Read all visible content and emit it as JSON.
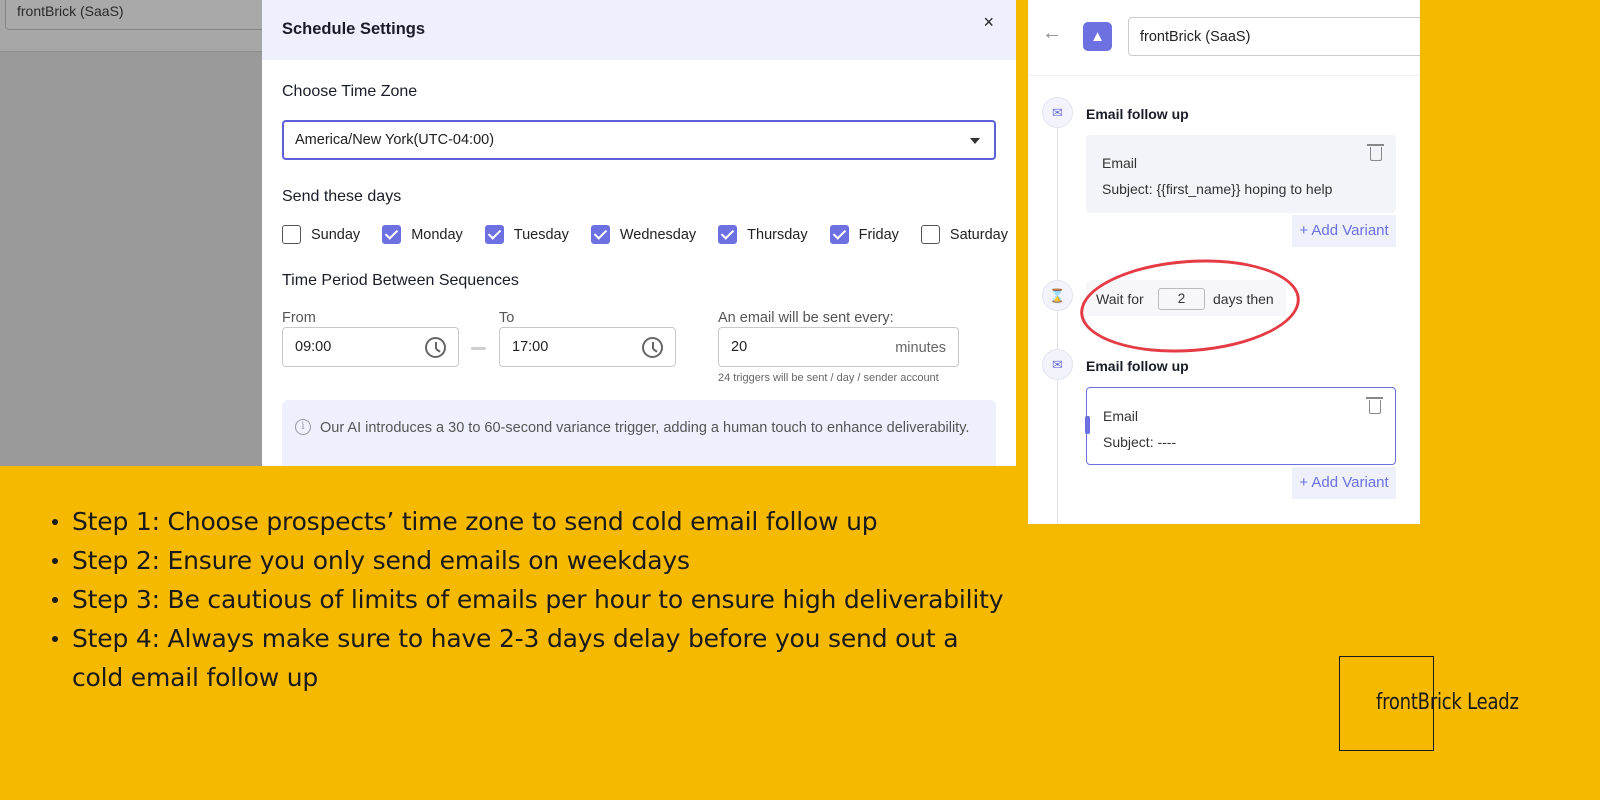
{
  "background_app": {
    "campaign_name": "frontBrick (SaaS)"
  },
  "modal": {
    "title": "Schedule Settings",
    "close_label": "×",
    "timezone_label": "Choose Time Zone",
    "timezone_value": "America/New York(UTC-04:00)",
    "days_label": "Send these days",
    "days": [
      {
        "label": "Sunday",
        "checked": false
      },
      {
        "label": "Monday",
        "checked": true
      },
      {
        "label": "Tuesday",
        "checked": true
      },
      {
        "label": "Wednesday",
        "checked": true
      },
      {
        "label": "Thursday",
        "checked": true
      },
      {
        "label": "Friday",
        "checked": true
      },
      {
        "label": "Saturday",
        "checked": false
      }
    ],
    "period_label": "Time Period Between Sequences",
    "from_label": "From",
    "from_value": "09:00",
    "to_label": "To",
    "to_value": "17:00",
    "interval_label": "An email will be sent every:",
    "interval_value": "20",
    "interval_unit": "minutes",
    "trigger_hint": "24 triggers will be sent / day / sender account",
    "info_text": "Our AI introduces a 30 to 60-second variance trigger, adding a human touch to enhance deliverability."
  },
  "panel": {
    "back_icon": "←",
    "campaign_name": "frontBrick (SaaS)",
    "steps": [
      {
        "title": "Email follow up",
        "card_title": "Email",
        "subject": "Subject: {{first_name}} hoping to help",
        "add_variant": "+ Add Variant"
      },
      {
        "title": "Email follow up",
        "card_title": "Email",
        "subject": "Subject: ----",
        "add_variant": "+ Add Variant"
      }
    ],
    "wait": {
      "prefix": "Wait for",
      "value": "2",
      "suffix": "days then"
    }
  },
  "instructions": [
    "Step 1: Choose prospects’ time zone to send cold email follow up",
    "Step 2: Ensure you only send emails on weekdays",
    "Step 3: Be cautious of limits of emails per hour to ensure high deliverability",
    "Step 4: Always make sure to have 2-3 days delay before you send out a cold email follow up"
  ],
  "brand": {
    "name": "frontBrick Leadz"
  },
  "colors": {
    "background": "#f5b900",
    "accent": "#6c70e0",
    "annotation_red": "#e53b44"
  }
}
